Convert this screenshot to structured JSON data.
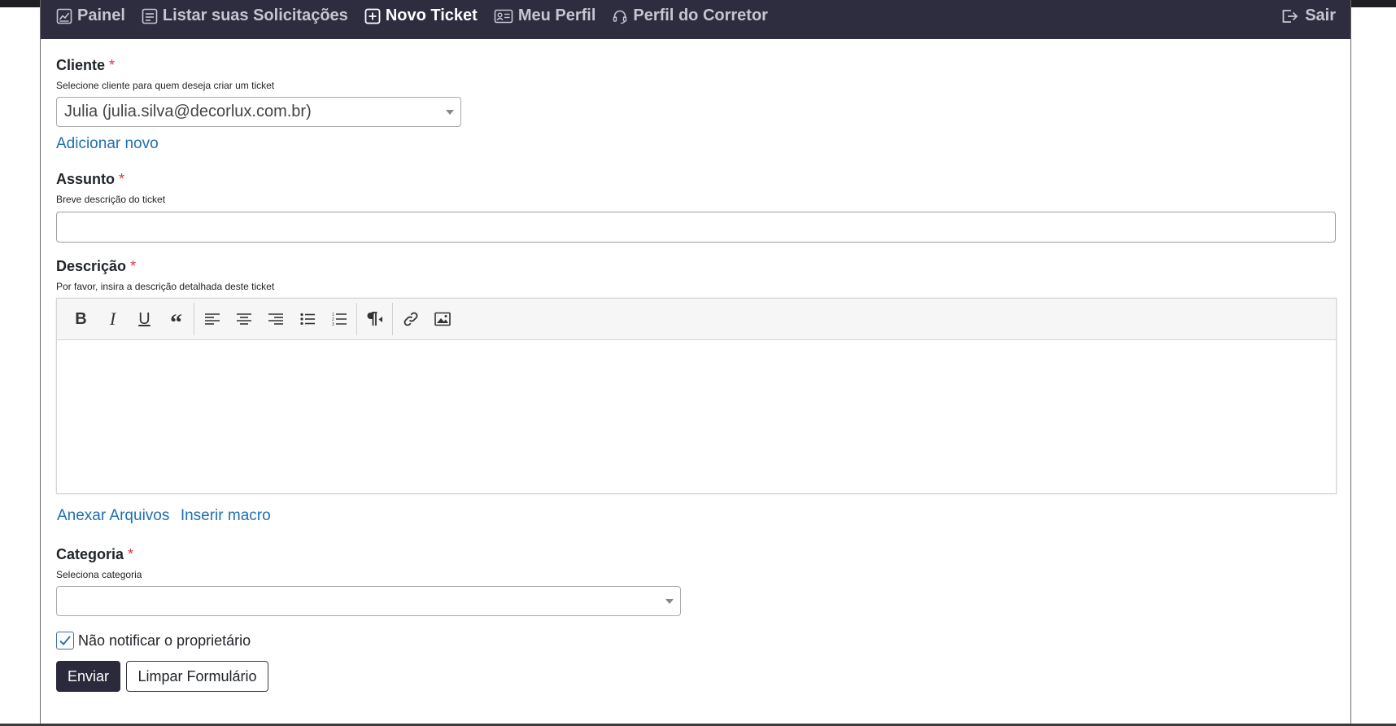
{
  "nav": {
    "items": [
      {
        "label": "Painel",
        "icon": "chart-icon"
      },
      {
        "label": "Listar suas Solicitações",
        "icon": "list-icon"
      },
      {
        "label": "Novo Ticket",
        "icon": "plus-square-icon"
      },
      {
        "label": "Meu Perfil",
        "icon": "id-card-icon"
      },
      {
        "label": "Perfil do Corretor",
        "icon": "headset-icon"
      }
    ],
    "logout_label": "Sair"
  },
  "form": {
    "cliente": {
      "label": "Cliente",
      "required": "*",
      "help": "Selecione cliente para quem deseja criar um ticket",
      "value": "Julia (julia.silva@decorlux.com.br)",
      "add_new": "Adicionar novo"
    },
    "assunto": {
      "label": "Assunto",
      "required": "*",
      "help": "Breve descrição do ticket",
      "value": ""
    },
    "descricao": {
      "label": "Descrição",
      "required": "*",
      "help": "Por favor, insira a descrição detalhada deste ticket",
      "toolbar": [
        "bold-icon",
        "italic-icon",
        "underline-icon",
        "quote-icon",
        "align-left-icon",
        "align-center-icon",
        "align-right-icon",
        "bullet-list-icon",
        "numbered-list-icon",
        "paragraph-direction-icon",
        "link-icon",
        "image-icon"
      ]
    },
    "attach_label": "Anexar Arquivos",
    "macro_label": "Inserir macro",
    "categoria": {
      "label": "Categoria",
      "required": "*",
      "help": "Seleciona categoria",
      "value": ""
    },
    "notify": {
      "label": "Não notificar o proprietário",
      "checked": true
    },
    "submit_label": "Enviar",
    "reset_label": "Limpar Formulário"
  }
}
